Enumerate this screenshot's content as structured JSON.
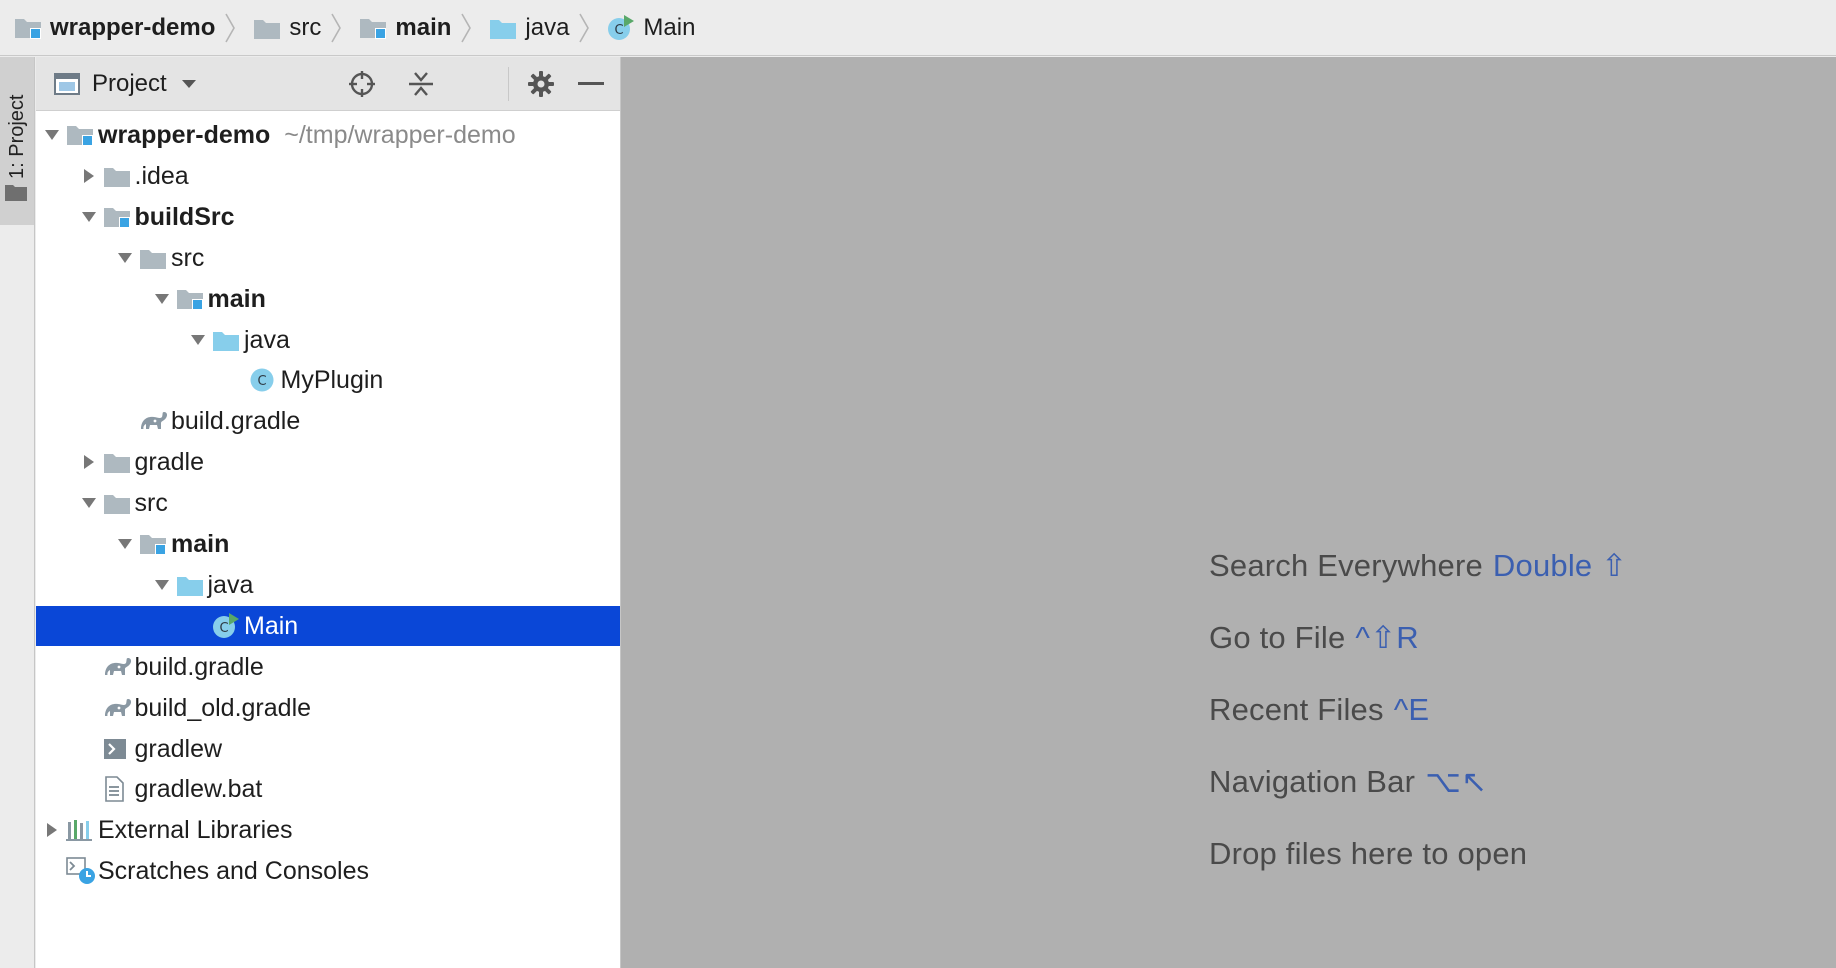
{
  "breadcrumbs": [
    {
      "label": "wrapper-demo",
      "icon": "module-folder-icon",
      "bold": true
    },
    {
      "label": "src",
      "icon": "folder-icon",
      "bold": false
    },
    {
      "label": "main",
      "icon": "module-folder-icon",
      "bold": true
    },
    {
      "label": "java",
      "icon": "source-folder-icon",
      "bold": false
    },
    {
      "label": "Main",
      "icon": "runnable-class-icon",
      "bold": false
    }
  ],
  "stripe": {
    "label": "1: Project"
  },
  "panel": {
    "view_label": "Project",
    "buttons": [
      "locate-icon",
      "collapse-all-icon",
      "gear-icon",
      "minimize-icon"
    ]
  },
  "tree": [
    {
      "label": "wrapper-demo",
      "hint": "~/tmp/wrapper-demo",
      "bold": true,
      "depth": 0,
      "arrow": "down",
      "icon": "module-folder-icon"
    },
    {
      "label": ".idea",
      "bold": false,
      "depth": 1,
      "arrow": "right",
      "icon": "folder-icon"
    },
    {
      "label": "buildSrc",
      "bold": true,
      "depth": 1,
      "arrow": "down",
      "icon": "module-folder-icon"
    },
    {
      "label": "src",
      "bold": false,
      "depth": 2,
      "arrow": "down",
      "icon": "folder-icon"
    },
    {
      "label": "main",
      "bold": true,
      "depth": 3,
      "arrow": "down",
      "icon": "module-folder-icon"
    },
    {
      "label": "java",
      "bold": false,
      "depth": 4,
      "arrow": "down",
      "icon": "source-folder-icon"
    },
    {
      "label": "MyPlugin",
      "bold": false,
      "depth": 5,
      "arrow": "none",
      "icon": "class-icon"
    },
    {
      "label": "build.gradle",
      "bold": false,
      "depth": 2,
      "arrow": "none",
      "icon": "gradle-icon"
    },
    {
      "label": "gradle",
      "bold": false,
      "depth": 1,
      "arrow": "right",
      "icon": "folder-icon"
    },
    {
      "label": "src",
      "bold": false,
      "depth": 1,
      "arrow": "down",
      "icon": "folder-icon"
    },
    {
      "label": "main",
      "bold": true,
      "depth": 2,
      "arrow": "down",
      "icon": "module-folder-icon"
    },
    {
      "label": "java",
      "bold": false,
      "depth": 3,
      "arrow": "down",
      "icon": "source-folder-icon"
    },
    {
      "label": "Main",
      "bold": false,
      "depth": 4,
      "arrow": "none",
      "icon": "runnable-class-icon",
      "selected": true
    },
    {
      "label": "build.gradle",
      "bold": false,
      "depth": 1,
      "arrow": "none",
      "icon": "gradle-icon"
    },
    {
      "label": "build_old.gradle",
      "bold": false,
      "depth": 1,
      "arrow": "none",
      "icon": "gradle-icon"
    },
    {
      "label": "gradlew",
      "bold": false,
      "depth": 1,
      "arrow": "none",
      "icon": "shell-script-icon"
    },
    {
      "label": "gradlew.bat",
      "bold": false,
      "depth": 1,
      "arrow": "none",
      "icon": "text-file-icon"
    },
    {
      "label": "External Libraries",
      "bold": false,
      "depth": 0,
      "arrow": "right",
      "icon": "libraries-icon"
    },
    {
      "label": "Scratches and Consoles",
      "bold": false,
      "depth": 0,
      "arrow": "none",
      "icon": "scratches-icon"
    }
  ],
  "editor": {
    "tips": [
      {
        "label": "Search Everywhere",
        "shortcut": "Double ⇧"
      },
      {
        "label": "Go to File",
        "shortcut": "^⇧R"
      },
      {
        "label": "Recent Files",
        "shortcut": "^E"
      },
      {
        "label": "Navigation Bar",
        "shortcut": "⌥↖"
      },
      {
        "label": "Drop files here to open",
        "shortcut": ""
      }
    ]
  },
  "colors": {
    "selection": "#0a47d7",
    "folder": "#aeb9c0",
    "source_folder": "#87ceeb",
    "module_marker": "#3aa3e3",
    "class": "#87ceeb",
    "run_marker": "#59a869",
    "shortcut_text": "#3b5fb0",
    "editor_bg": "#b0b0b0"
  }
}
